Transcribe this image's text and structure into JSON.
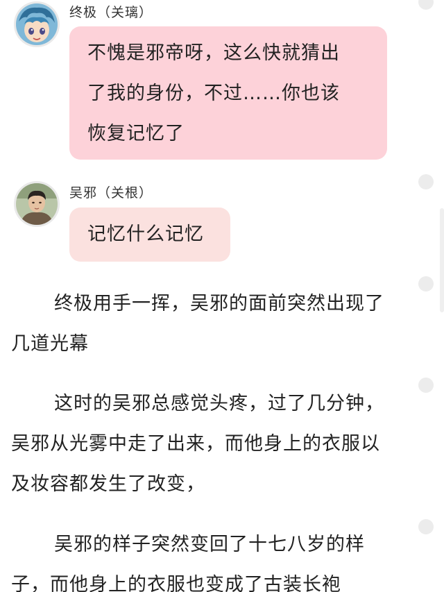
{
  "messages": [
    {
      "sender": "终极（关璃）",
      "avatar_icon": "anime-character-avatar",
      "lines": [
        "不愧是邪帝呀，这么快就猜出",
        "了我的身份，不过……你也该",
        "恢复记忆了"
      ],
      "bubble_color": "#fdd2d9"
    },
    {
      "sender": "吴邪（关根）",
      "avatar_icon": "young-man-portrait-avatar",
      "text": "记忆什么记忆",
      "bubble_color": "#fbe1df"
    }
  ],
  "narration": [
    {
      "lines": [
        "终极用手一挥，吴邪的面前突然出现了",
        "几道光幕"
      ]
    },
    {
      "lines": [
        "这时的吴邪总感觉头疼，过了几分钟，",
        "吴邪从光雾中走了出来，而他身上的衣服以",
        "及妆容都发生了改变，"
      ]
    },
    {
      "lines": [
        "吴邪的样子突然变回了十七八岁的样",
        "子，而他身上的衣服也变成了古装长袍"
      ]
    }
  ]
}
